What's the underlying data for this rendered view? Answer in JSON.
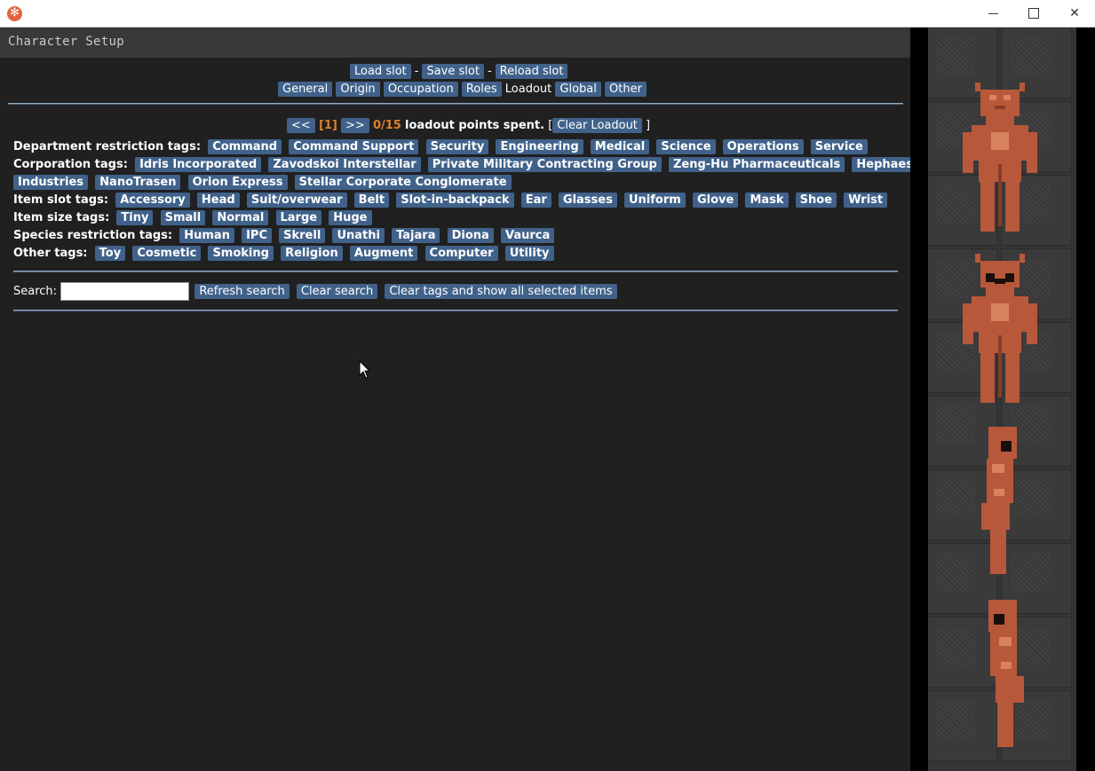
{
  "window": {
    "title": "",
    "controls": [
      "minimize",
      "maximize",
      "close"
    ]
  },
  "panel": {
    "title": "Character Setup"
  },
  "slots": {
    "load": "Load slot",
    "save": "Save slot",
    "reload": "Reload slot",
    "dash": "-"
  },
  "tabs": [
    {
      "label": "General",
      "active": false
    },
    {
      "label": "Origin",
      "active": false
    },
    {
      "label": "Occupation",
      "active": false
    },
    {
      "label": "Roles",
      "active": false
    },
    {
      "label": "Loadout",
      "active": true
    },
    {
      "label": "Global",
      "active": false
    },
    {
      "label": "Other",
      "active": false
    }
  ],
  "loadout": {
    "prev": "<<",
    "page": "[1]",
    "next": ">>",
    "points": "0/15",
    "points_text": "loadout points spent.",
    "bracket_open": "[",
    "clear": "Clear Loadout",
    "bracket_close": "]"
  },
  "tags": {
    "department": {
      "label": "Department restriction tags:",
      "items": [
        "Command",
        "Command Support",
        "Security",
        "Engineering",
        "Medical",
        "Science",
        "Operations",
        "Service"
      ]
    },
    "corporation": {
      "label": "Corporation tags:",
      "items": [
        "Idris Incorporated",
        "Zavodskoi Interstellar",
        "Private Military Contracting Group",
        "Zeng-Hu Pharmaceuticals",
        "Hephaestus",
        "Industries",
        "NanoTrasen",
        "Orion Express",
        "Stellar Corporate Conglomerate"
      ]
    },
    "slot": {
      "label": "Item slot tags:",
      "items": [
        "Accessory",
        "Head",
        "Suit/overwear",
        "Belt",
        "Slot-in-backpack",
        "Ear",
        "Glasses",
        "Uniform",
        "Glove",
        "Mask",
        "Shoe",
        "Wrist"
      ]
    },
    "size": {
      "label": "Item size tags:",
      "items": [
        "Tiny",
        "Small",
        "Normal",
        "Large",
        "Huge"
      ]
    },
    "species": {
      "label": "Species restriction tags:",
      "items": [
        "Human",
        "IPC",
        "Skrell",
        "Unathi",
        "Tajara",
        "Diona",
        "Vaurca"
      ]
    },
    "other": {
      "label": "Other tags:",
      "items": [
        "Toy",
        "Cosmetic",
        "Smoking",
        "Religion",
        "Augment",
        "Computer",
        "Utility"
      ]
    }
  },
  "search": {
    "label": "Search:",
    "value": "",
    "placeholder": "",
    "refresh": "Refresh search",
    "clear": "Clear search",
    "clear_tags": "Clear tags and show all selected items"
  },
  "colors": {
    "button": "#40628a",
    "points": "#e0812c",
    "background": "#202020",
    "header": "#383838"
  },
  "preview": {
    "sprites": [
      "vaurca-front",
      "vaurca-front-masked",
      "vaurca-side-left",
      "vaurca-side-right"
    ]
  }
}
